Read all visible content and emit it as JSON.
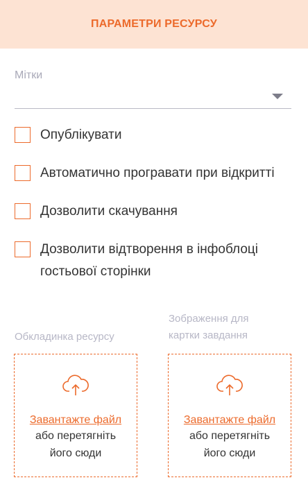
{
  "header": {
    "title": "ПАРАМЕТРИ РЕСУРСУ"
  },
  "tags": {
    "label": "Мітки",
    "value": ""
  },
  "checkboxes": [
    {
      "label": "Опублікувати",
      "checked": false
    },
    {
      "label": "Автоматично програвати при відкритті",
      "checked": false
    },
    {
      "label": "Дозволити скачування",
      "checked": false
    },
    {
      "label": "Дозволити відтворення в інфоблоці гостьової сторінки",
      "checked": false
    }
  ],
  "cover": {
    "label": "Обкладинка ресурсу",
    "link": "Завантажте файл",
    "hint_line1": "або перетягніть",
    "hint_line2": "його сюди"
  },
  "task_image": {
    "label_line1": "Зображення для",
    "label_line2": "картки завдання",
    "link": "Завантажте файл",
    "hint_line1": "або перетягніть",
    "hint_line2": "його сюди"
  },
  "colors": {
    "accent": "#ec6a2b",
    "header_bg": "#fde3d3"
  },
  "icons": {
    "dropdown": "chevron-down-icon",
    "upload": "cloud-upload-icon"
  }
}
